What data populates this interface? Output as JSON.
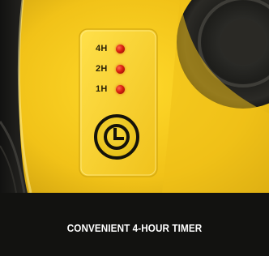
{
  "image": {
    "subject": "yellow device timer panel",
    "colors": {
      "housing": "#f0c419",
      "dark": "#121210",
      "led": "#d8210f",
      "caption_text": "#ffffff"
    }
  },
  "timer_panel": {
    "settings": [
      {
        "label": "4H",
        "indicator": "led-icon"
      },
      {
        "label": "2H",
        "indicator": "led-icon"
      },
      {
        "label": "1H",
        "indicator": "led-icon"
      }
    ],
    "button_icon": "clock-icon"
  },
  "caption": {
    "text": "CONVENIENT 4-HOUR TIMER"
  }
}
